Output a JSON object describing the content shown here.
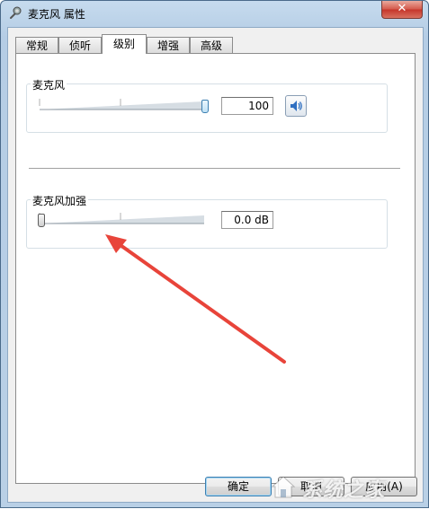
{
  "window": {
    "title": "麦克风 属性",
    "close_label": "✕"
  },
  "tabs": [
    {
      "label": "常规",
      "active": false
    },
    {
      "label": "侦听",
      "active": false
    },
    {
      "label": "级别",
      "active": true
    },
    {
      "label": "增强",
      "active": false
    },
    {
      "label": "高级",
      "active": false
    }
  ],
  "levels": {
    "microphone": {
      "label": "麦克风",
      "value": "100",
      "level": 1.0
    },
    "boost": {
      "label": "麦克风加强",
      "value": "0.0 dB",
      "level": 0.0
    }
  },
  "buttons": {
    "ok": "确定",
    "cancel": "取消",
    "apply": "应用(A)"
  },
  "watermark": {
    "text": "系统之家"
  },
  "icons": {
    "title": "microphone-icon",
    "mute": "speaker-icon",
    "watermark": "house-logo-icon"
  },
  "colors": {
    "annotation_arrow": "#e8443a",
    "titlebar": "#b9d0e6",
    "close_button": "#c5352a"
  }
}
